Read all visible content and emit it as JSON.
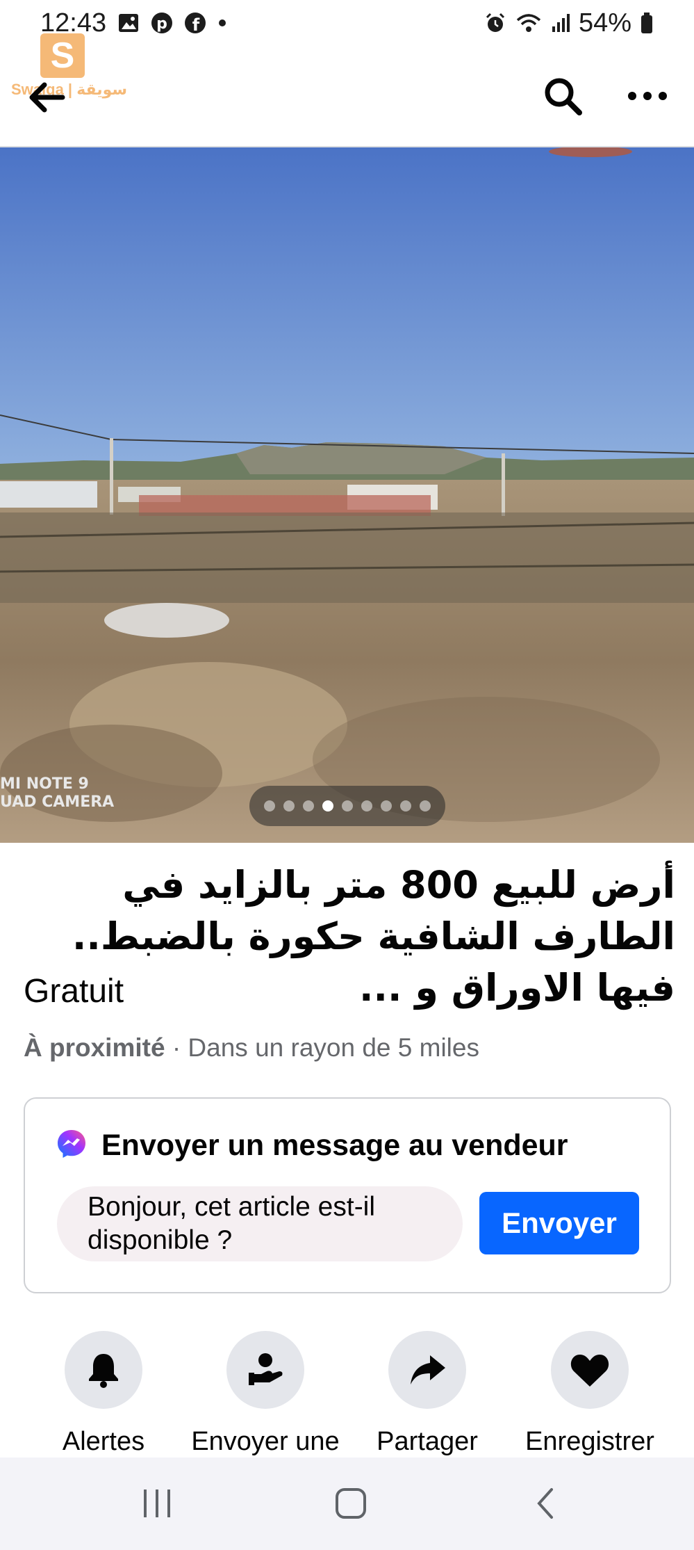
{
  "status_bar": {
    "time": "12:43",
    "battery": "54%",
    "left_icons": [
      "gallery-icon",
      "pinterest-icon",
      "facebook-icon",
      "dot-icon"
    ],
    "right_icons": [
      "alarm-icon",
      "wifi-icon",
      "signal-icon",
      "battery-icon"
    ]
  },
  "watermark": {
    "mark": "S",
    "text": "Swaiqa | سويقة"
  },
  "app_bar": {
    "icons": [
      "back-arrow-icon",
      "search-icon",
      "more-icon"
    ]
  },
  "photo": {
    "camera_stamp_line1": "MI NOTE 9",
    "camera_stamp_line2": "UAD CAMERA",
    "image_count": 9,
    "active_image": 4
  },
  "listing": {
    "title": "أرض للبيع 800 متر بالزايد في الطارف الشافية حكورة بالضبط.. فيها الاوراق و ...",
    "price": "Gratuit",
    "location_bold": "À proximité",
    "location_rest": " · Dans un rayon de 5 miles"
  },
  "message": {
    "title": "Envoyer un message au vendeur",
    "input_value": "Bonjour, cet article est-il disponible ?",
    "send_label": "Envoyer"
  },
  "actions": [
    {
      "label": "Alertes",
      "icon": "bell-icon"
    },
    {
      "label": "Envoyer une",
      "icon": "send-offer-icon"
    },
    {
      "label": "Partager",
      "icon": "share-icon"
    },
    {
      "label": "Enregistrer",
      "icon": "heart-icon"
    }
  ],
  "nav": {
    "icons": [
      "recent-apps-icon",
      "home-icon",
      "back-icon"
    ]
  },
  "colors": {
    "accent": "#0866ff",
    "secondary_text": "#65676b",
    "card_border": "#ced0d4"
  }
}
